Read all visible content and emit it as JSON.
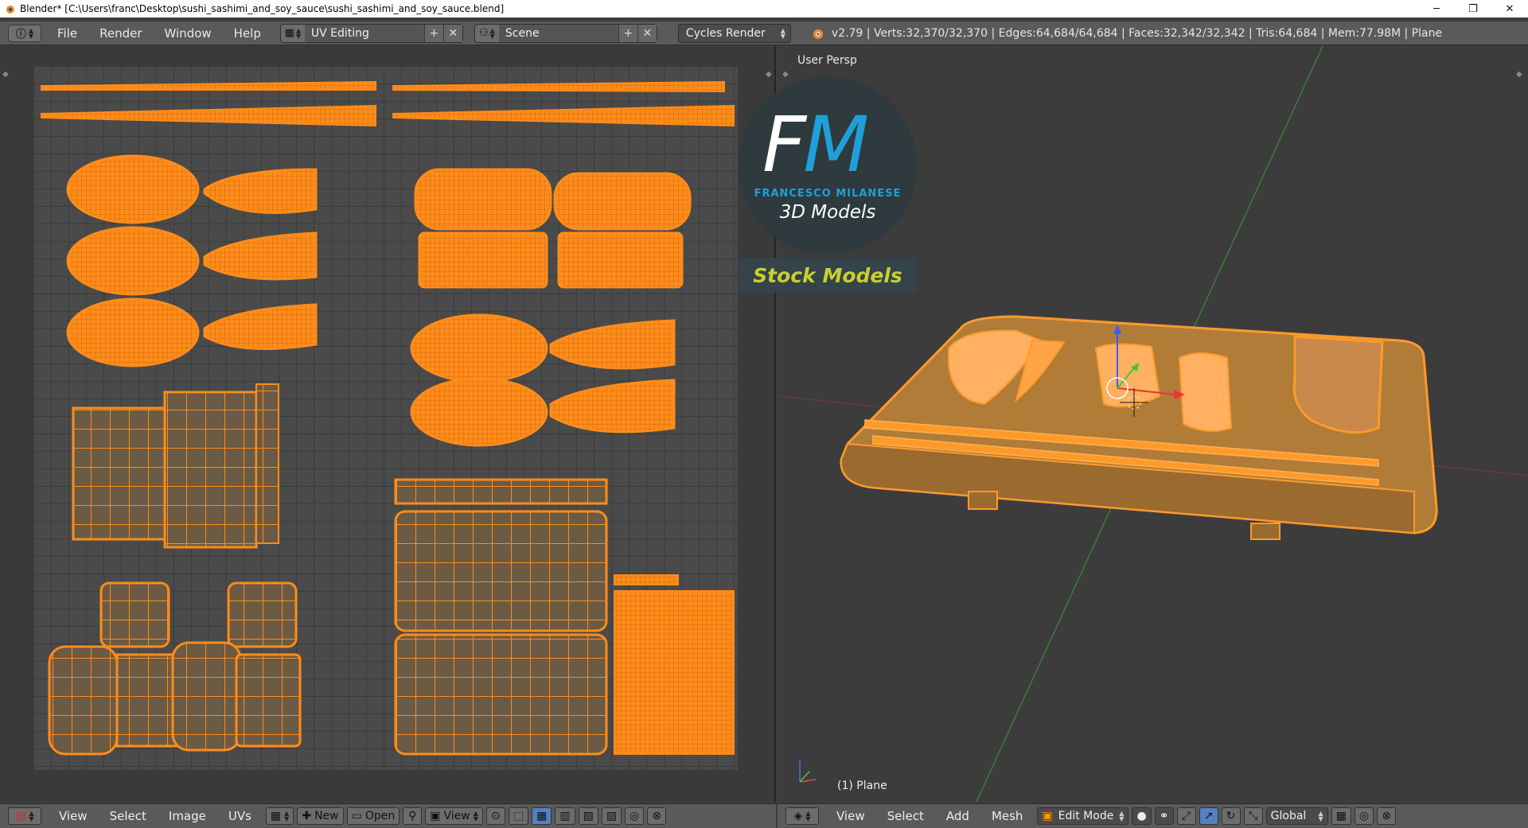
{
  "window": {
    "title": "Blender* [C:\\Users\\franc\\Desktop\\sushi_sashimi_and_soy_sauce\\sushi_sashimi_and_soy_sauce.blend]",
    "minimize": "─",
    "maximize": "❐",
    "close": "✕"
  },
  "infobar": {
    "menus": [
      "File",
      "Render",
      "Window",
      "Help"
    ],
    "layout": "UV Editing",
    "scene": "Scene",
    "engine": "Cycles Render",
    "stats": "v2.79 | Verts:32,370/32,370 | Edges:64,684/64,684 | Faces:32,342/32,342 | Tris:64,684 | Mem:77.98M | Plane"
  },
  "uv_editor": {
    "menus": [
      "View",
      "Select",
      "Image",
      "UVs"
    ],
    "new_label": "New",
    "open_label": "Open",
    "view_label": "View"
  },
  "viewport": {
    "view_name": "User Persp",
    "object_label": "(1) Plane",
    "menus": [
      "View",
      "Select",
      "Add",
      "Mesh"
    ],
    "mode": "Edit Mode",
    "orientation": "Global"
  },
  "watermark": {
    "logo_f": "F",
    "logo_m": "M",
    "brand": "FRANCESCO MILANESE",
    "subtitle": "3D Models",
    "stock": "Stock Models"
  },
  "colors": {
    "uv_orange": "#ff8c1a",
    "accent_blue": "#1fa0d8",
    "stock_yellow": "#c9cf2f"
  }
}
